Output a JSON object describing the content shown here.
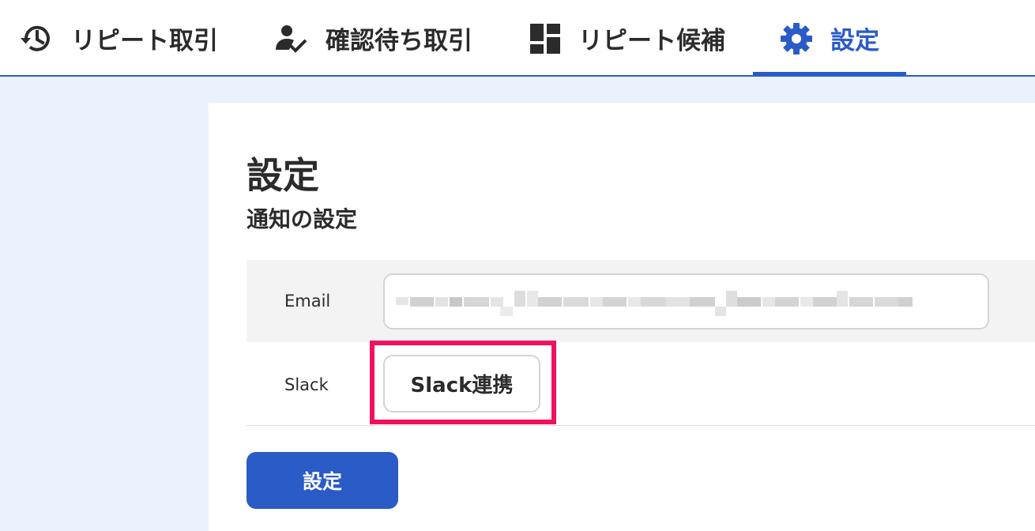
{
  "nav": {
    "tabs": [
      {
        "label": "リピート取引",
        "icon": "history-icon",
        "active": false
      },
      {
        "label": "確認待ち取引",
        "icon": "person-check-icon",
        "active": false
      },
      {
        "label": "リピート候補",
        "icon": "dashboard-icon",
        "active": false
      },
      {
        "label": "設定",
        "icon": "gear-icon",
        "active": true
      }
    ]
  },
  "main": {
    "title": "設定",
    "section_title": "通知の設定",
    "email": {
      "label": "Email",
      "value": ""
    },
    "slack": {
      "label": "Slack",
      "button_label": "Slack連携"
    },
    "submit_label": "設定"
  },
  "colors": {
    "accent": "#2a5bc7",
    "page_background": "#e9f1fd",
    "highlight": "#f0115f"
  }
}
